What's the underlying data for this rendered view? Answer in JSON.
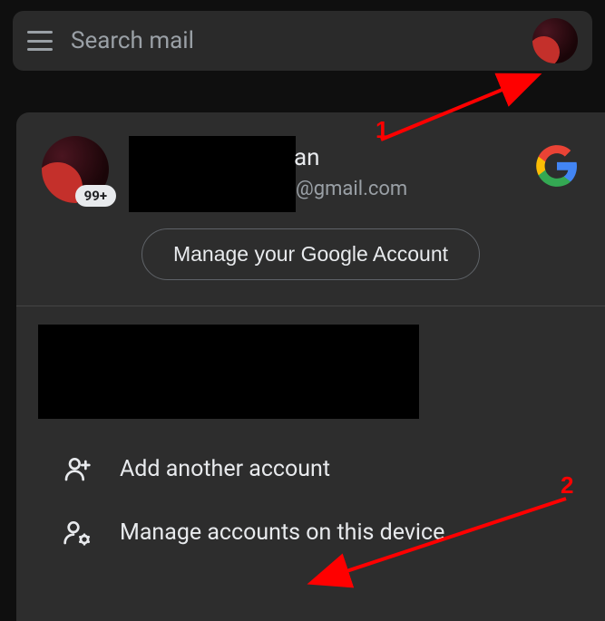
{
  "search": {
    "placeholder": "Search mail"
  },
  "account": {
    "name_suffix": "an",
    "email_suffix": "@gmail.com",
    "badge": "99+",
    "manage_button": "Manage your Google Account"
  },
  "menu": {
    "add_account": "Add another account",
    "manage_device": "Manage accounts on this device"
  },
  "annotations": {
    "label1": "1",
    "label2": "2"
  },
  "colors": {
    "accent_red": "#ff0000",
    "google_blue": "#4285F4",
    "google_red": "#EA4335",
    "google_yellow": "#FBBC05",
    "google_green": "#34A853"
  }
}
